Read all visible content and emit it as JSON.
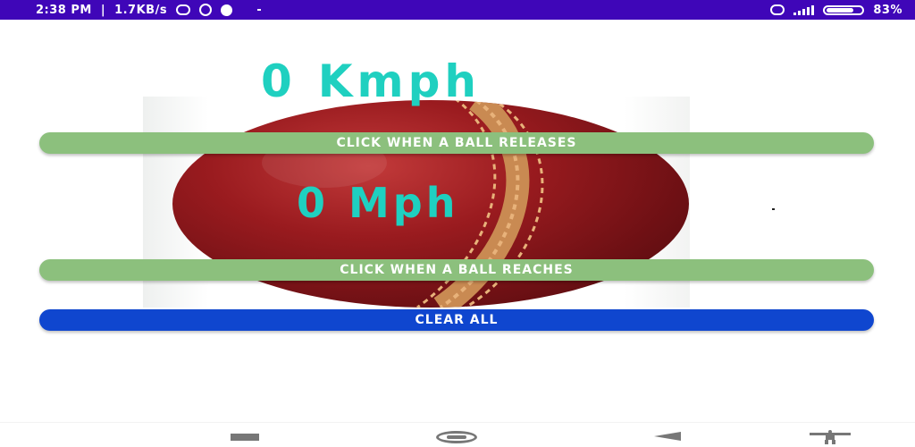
{
  "status_bar": {
    "time": "2:38 PM",
    "separator": "|",
    "net_speed": "1.7KB/s",
    "battery_text": "83%",
    "background_color": "#3f06b8"
  },
  "speeds": {
    "kmph_value": "0",
    "kmph_unit": "Kmph",
    "mph_value": "0",
    "mph_unit": "Mph",
    "text_color": "#1fd0c0"
  },
  "buttons": {
    "release_label": "CLICK WHEN A BALL RELEASES",
    "reach_label": "CLICK WHEN A BALL REACHES",
    "clear_label": "CLEAR ALL",
    "green_color": "#8cc07d",
    "blue_color": "#0f46cf"
  },
  "image": {
    "subject": "cricket-ball"
  },
  "nav_bar": {
    "icons": [
      "recent-apps-icon",
      "home-icon",
      "back-icon",
      "accessibility-icon"
    ]
  }
}
